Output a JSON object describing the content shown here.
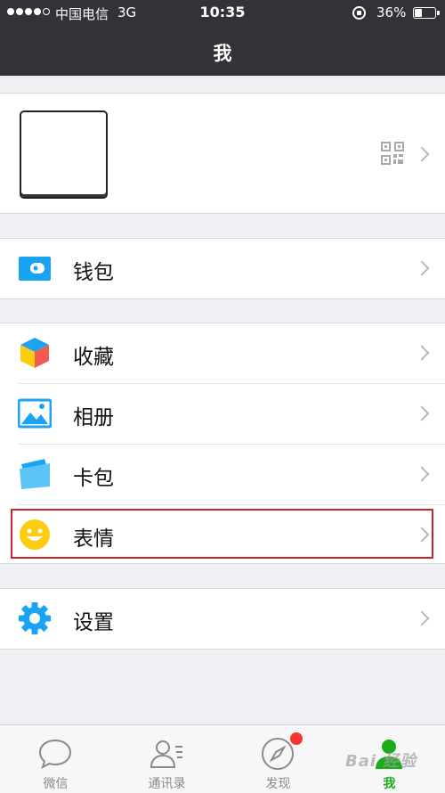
{
  "status_bar": {
    "carrier": "中国电信",
    "network": "3G",
    "time": "10:35",
    "battery_percent": "36%",
    "battery_level": 0.36,
    "signal_bars": 4
  },
  "nav": {
    "title": "我"
  },
  "profile": {
    "avatar_icon": "avatar-blank",
    "qr_icon": "qr-code-icon"
  },
  "menu": {
    "wallet": {
      "label": "钱包",
      "icon": "wallet-icon",
      "color": "#1aa3f2"
    },
    "favorites": {
      "label": "收藏",
      "icon": "cube-icon"
    },
    "album": {
      "label": "相册",
      "icon": "photo-icon",
      "color": "#1aa3f2"
    },
    "cards": {
      "label": "卡包",
      "icon": "card-icon",
      "color": "#1aa3f2"
    },
    "stickers": {
      "label": "表情",
      "icon": "smiley-icon",
      "color": "#fccc10"
    },
    "settings": {
      "label": "设置",
      "icon": "gear-icon",
      "color": "#1aa3f2"
    }
  },
  "tabs": [
    {
      "label": "微信",
      "icon": "chat-bubble-icon"
    },
    {
      "label": "通讯录",
      "icon": "contacts-icon"
    },
    {
      "label": "发现",
      "icon": "compass-icon"
    },
    {
      "label": "我",
      "icon": "person-icon",
      "active": true
    }
  ],
  "highlight_color": "#cc2230",
  "active_color": "#1aad19",
  "watermark": "Bai 经验"
}
